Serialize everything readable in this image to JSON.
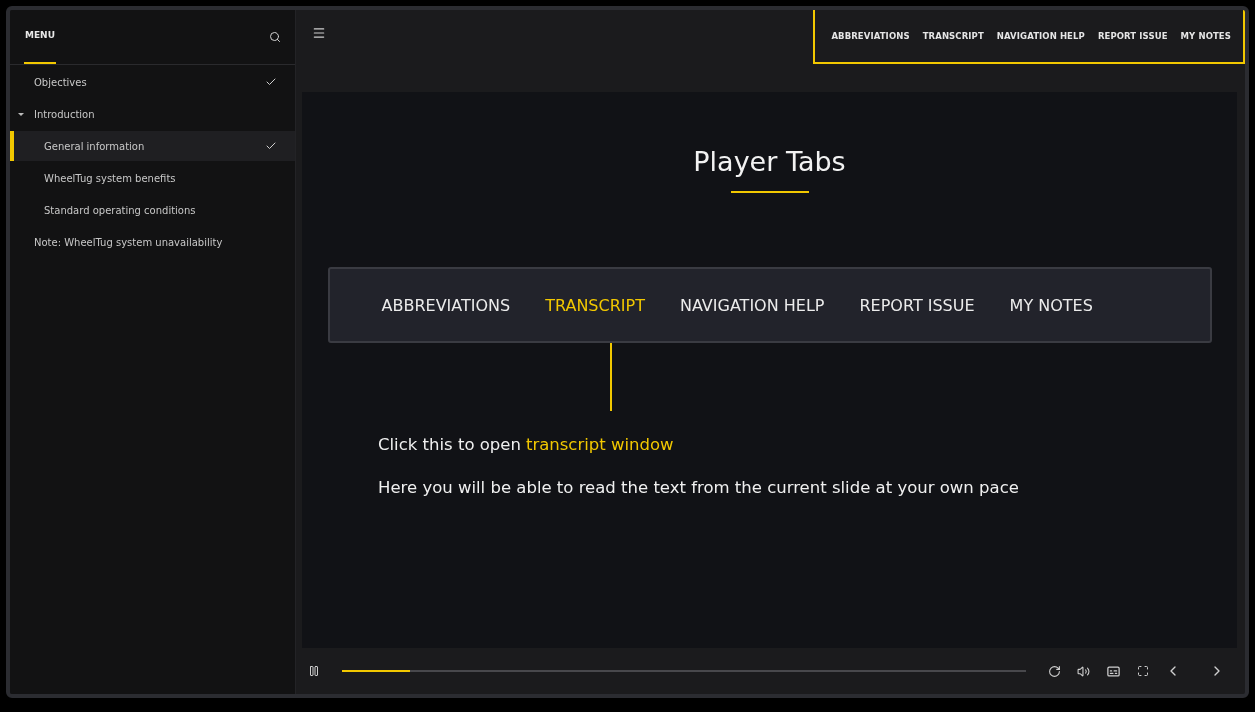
{
  "menu": {
    "title": "MENU",
    "items": [
      {
        "label": "Objectives",
        "checked": true,
        "selected": false
      },
      {
        "label": "Introduction",
        "checked": false,
        "selected": false,
        "expanded": true,
        "children": [
          {
            "label": "General information",
            "checked": true,
            "selected": true
          },
          {
            "label": "WheelTug system benefits",
            "checked": false,
            "selected": false
          },
          {
            "label": "Standard operating conditions",
            "checked": false,
            "selected": false
          }
        ]
      },
      {
        "label": "Note: WheelTug system unavailability",
        "checked": false,
        "selected": false
      }
    ]
  },
  "top_tabs": {
    "highlighted": true,
    "items": [
      "ABBREVIATIONS",
      "TRANSCRIPT",
      "NAVIGATION HELP",
      "REPORT ISSUE",
      "MY NOTES"
    ]
  },
  "slide": {
    "title": "Player Tabs",
    "tabs": [
      {
        "label": "ABBREVIATIONS",
        "selected": false
      },
      {
        "label": "TRANSCRIPT",
        "selected": true
      },
      {
        "label": "NAVIGATION HELP",
        "selected": false
      },
      {
        "label": "REPORT ISSUE",
        "selected": false
      },
      {
        "label": "MY NOTES",
        "selected": false
      }
    ],
    "callout_lead": "Click this to open",
    "callout_highlight": "transcript window",
    "description": "Here you will be able to read the text from the current slide at your own pace"
  },
  "player": {
    "level": 0.1
  }
}
